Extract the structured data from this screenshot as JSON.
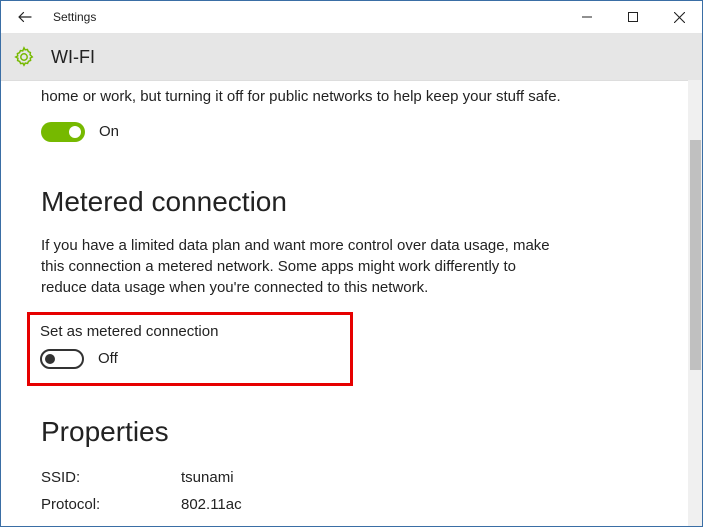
{
  "window": {
    "title": "Settings"
  },
  "header": {
    "page_title": "WI-FI"
  },
  "top_section": {
    "partial_text": "home or work, but turning it off for public networks to help keep your stuff safe.",
    "toggle_label": "On"
  },
  "metered": {
    "heading": "Metered connection",
    "description": "If you have a limited data plan and want more control over data usage, make this connection a metered network. Some apps might work differently to reduce data usage when you're connected to this network.",
    "set_label": "Set as metered connection",
    "toggle_label": "Off"
  },
  "properties": {
    "heading": "Properties",
    "rows": [
      {
        "key": "SSID:",
        "value": "tsunami"
      },
      {
        "key": "Protocol:",
        "value": "802.11ac"
      }
    ]
  }
}
